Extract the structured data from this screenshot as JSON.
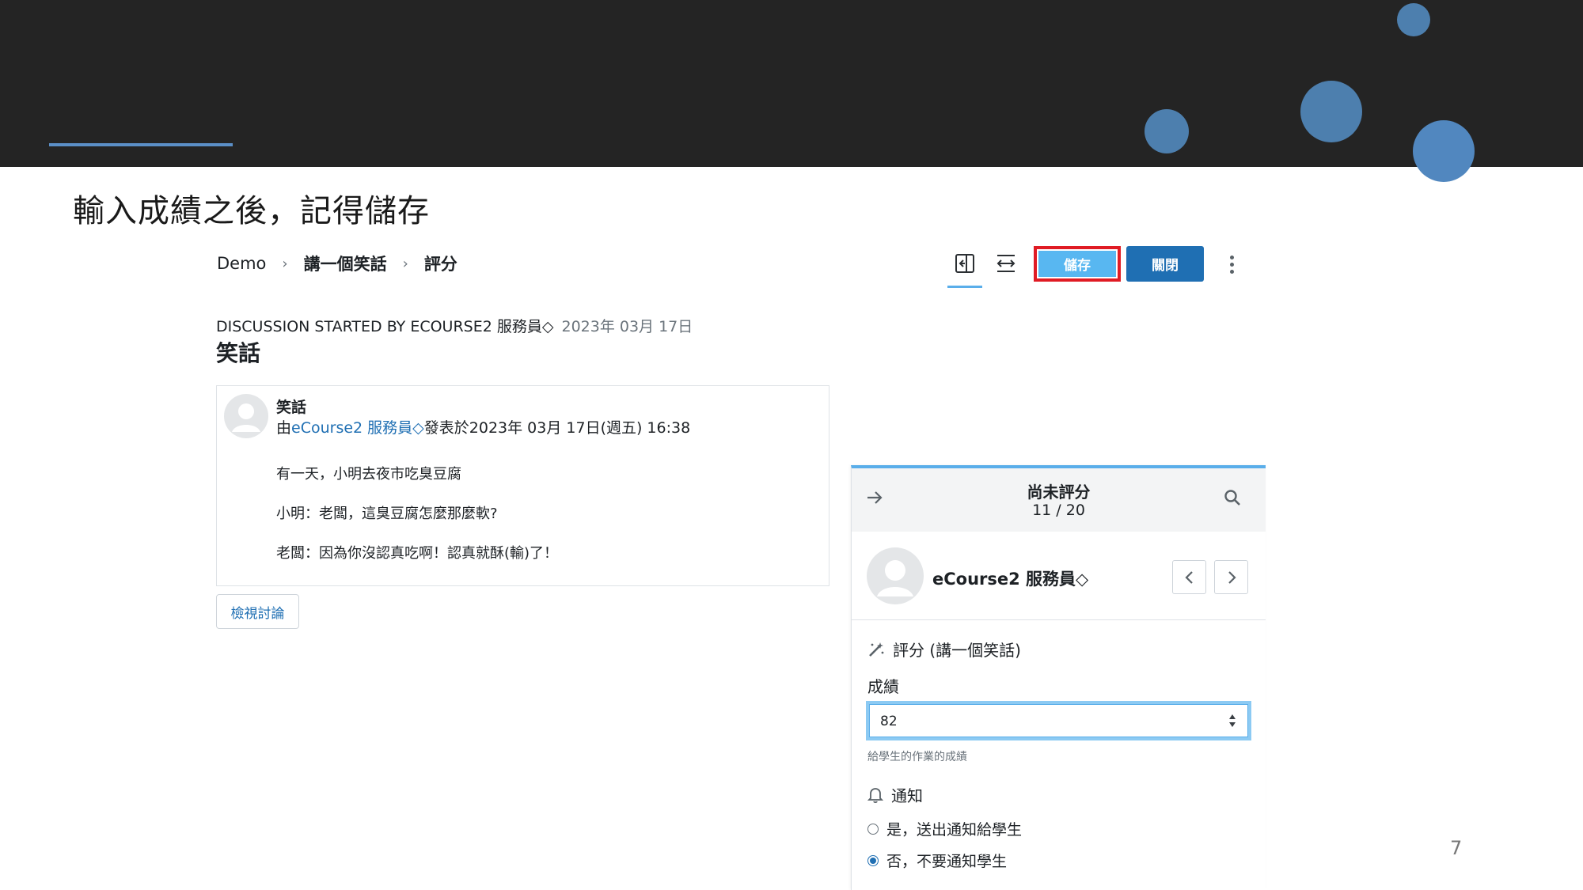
{
  "slide": {
    "title": "輸入成績之後，記得儲存",
    "page_number": "7"
  },
  "breadcrumb": {
    "items": [
      "Demo",
      "講一個笑話",
      "評分"
    ],
    "separator": "›"
  },
  "toolbar": {
    "save_label": "儲存",
    "close_label": "關閉",
    "icons": [
      "collapse-panel-icon",
      "expand-horizontal-icon",
      "kebab-menu-icon"
    ]
  },
  "discussion": {
    "started_by": "DISCUSSION STARTED BY ECOURSE2 服務員◇",
    "date": "2023年 03月 17日",
    "title": "笑話"
  },
  "post": {
    "subject": "笑話",
    "by_prefix": "由",
    "author": "eCourse2 服務員◇",
    "posted": "發表於2023年 03月 17日(週五) 16:38",
    "lines": [
      "有一天，小明去夜市吃臭豆腐",
      "小明：老闆，這臭豆腐怎麼那麼軟?",
      "老闆：因為你沒認真吃啊！認真就酥(輸)了！"
    ],
    "view_button": "檢視討論"
  },
  "grading": {
    "status": "尚未評分",
    "count": "11 / 20",
    "student_name": "eCourse2 服務員◇",
    "grade_heading": "評分 (講一個笑話)",
    "grade_label": "成績",
    "grade_value": "82",
    "grade_help": "給學生的作業的成績",
    "notify_heading": "通知",
    "notify_options": [
      {
        "label": "是，送出通知給學生",
        "checked": false
      },
      {
        "label": "否，不要通知學生",
        "checked": true
      }
    ]
  },
  "colors": {
    "header_band": "#242424",
    "accent_dot": "#4d7fae",
    "save_button": "#58b7f1",
    "save_highlight": "#e01b24",
    "close_button": "#1f6fb3",
    "link": "#1f6fb3"
  }
}
